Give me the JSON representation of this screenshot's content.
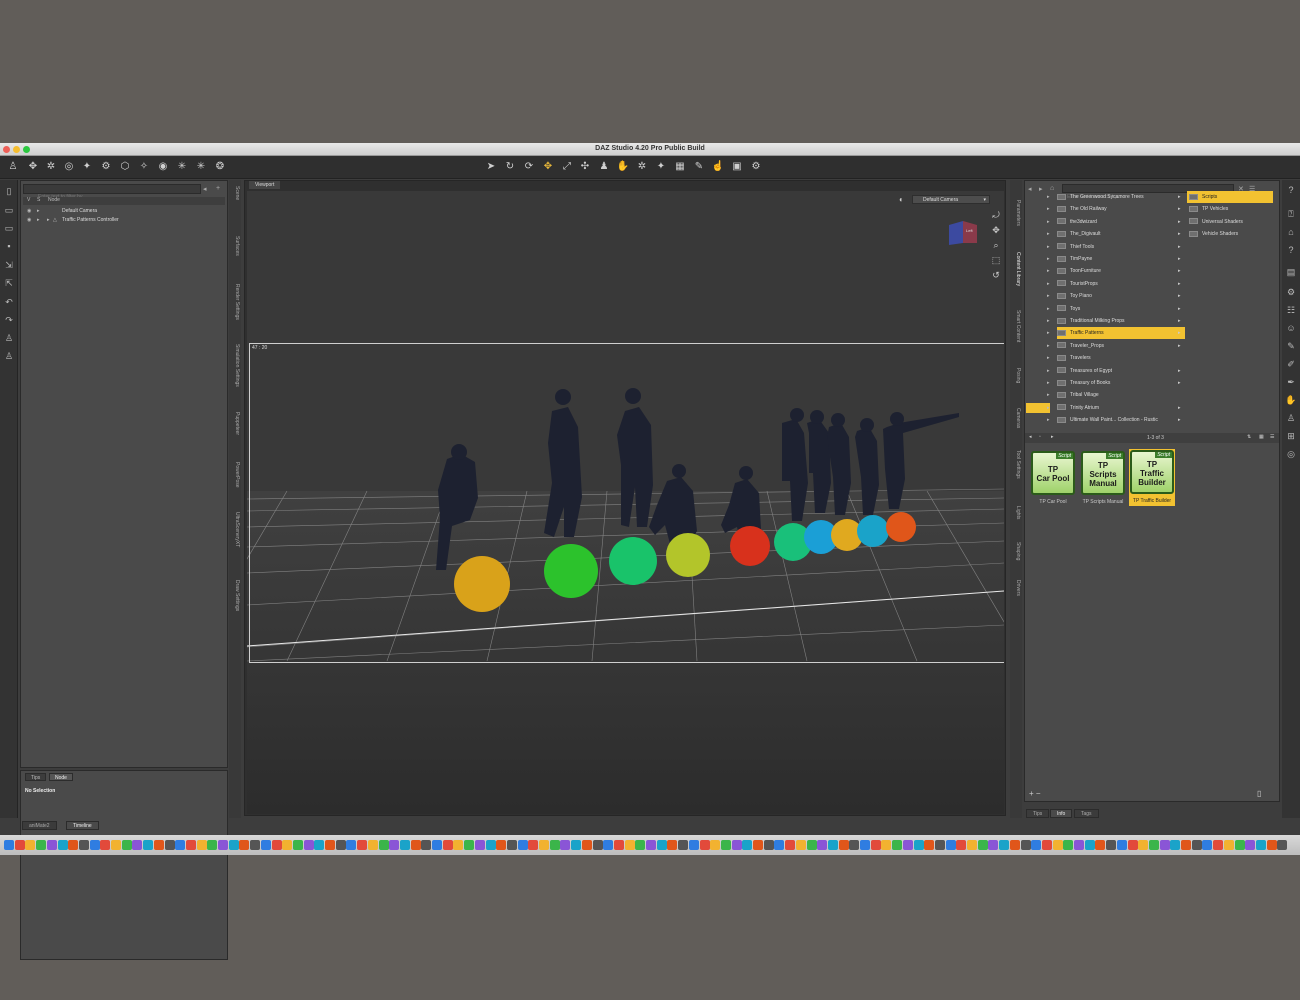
{
  "window": {
    "title": "DAZ Studio 4.20 Pro Public Build"
  },
  "scene": {
    "filter_placeholder": "Enter text to filter by...",
    "header_v": "V",
    "header_s": "S",
    "header_node": "Node",
    "nodes": [
      {
        "label": "Default Camera"
      },
      {
        "label": "Traffic Patterns Controller"
      }
    ]
  },
  "properties": {
    "tabs": [
      "Tips",
      "Node"
    ],
    "status": "No Selection"
  },
  "left_tabs": [
    "Scene",
    "Surfaces",
    "Render Settings",
    "Simulation Settings",
    "Puppeteer",
    "PowerPose",
    "UltraSceneryXT",
    "Draw Settings"
  ],
  "viewport": {
    "tab": "Viewport",
    "camera": "Default Camera",
    "aspect": "47 : 20",
    "cube_face": "Left"
  },
  "right_tabs": [
    "Parameters",
    "Content Library",
    "Smart Content",
    "Posing",
    "Cameras",
    "Tool Settings",
    "Lights",
    "Shaping",
    "Drivers"
  ],
  "content": {
    "search_placeholder": "Enter text to search by...",
    "folders": [
      {
        "label": "The Greenwood Sycamore Trees",
        "sub": true
      },
      {
        "label": "The Old Railway",
        "sub": true
      },
      {
        "label": "the3dwizard",
        "sub": true
      },
      {
        "label": "The_Digivault",
        "sub": true
      },
      {
        "label": "Thief Tools",
        "sub": true
      },
      {
        "label": "TimPayne",
        "sub": true
      },
      {
        "label": "ToonFurniture",
        "sub": true
      },
      {
        "label": "TouristProps",
        "sub": true
      },
      {
        "label": "Toy Piano",
        "sub": true
      },
      {
        "label": "Toys",
        "sub": true
      },
      {
        "label": "Traditional Milking Props",
        "sub": true
      },
      {
        "label": "Traffic Patterns",
        "sub": true,
        "selected": true
      },
      {
        "label": "Traveler_Props",
        "sub": true
      },
      {
        "label": "Travelers",
        "sub": false
      },
      {
        "label": "Treasures of Egypt",
        "sub": true
      },
      {
        "label": "Treasury of Books",
        "sub": true
      },
      {
        "label": "Tribal Village",
        "sub": false
      },
      {
        "label": "Trinity Atrium",
        "sub": true
      },
      {
        "label": "Ultimate Wall Paint... Collection - Rustic",
        "sub": true
      }
    ],
    "subfolders": [
      {
        "label": "Scripts",
        "selected": true
      },
      {
        "label": "TP Vehicles"
      },
      {
        "label": "Universal Shaders"
      },
      {
        "label": "Vehicle Shaders"
      }
    ],
    "count": "1-3 of 3",
    "assets": [
      {
        "badge": "Script",
        "tile_line1": "TP",
        "tile_line2": "Car Pool",
        "tile_line3": "",
        "name": "TP Car Pool"
      },
      {
        "badge": "Script",
        "tile_line1": "TP",
        "tile_line2": "Scripts",
        "tile_line3": "Manual",
        "name": "TP Scripts Manual"
      },
      {
        "badge": "Script",
        "tile_line1": "TP",
        "tile_line2": "Traffic",
        "tile_line3": "Builder",
        "name": "TP Traffic Builder",
        "selected": true
      }
    ],
    "bottom_tabs": [
      "Tips",
      "Info",
      "Tags"
    ]
  },
  "bottom_tabs": [
    "aniMate2",
    "Timeline"
  ],
  "colors": {
    "accent": "#f2c231",
    "panel": "#4a4a4a",
    "viewport": "#393939"
  },
  "scene_objects": {
    "ball_colors": [
      "#d9a21a",
      "#2cc22c",
      "#19c36a",
      "#b3c52a",
      "#d8311c",
      "#19c07a",
      "#1b9fd6",
      "#e0a91f",
      "#1aa3c9",
      "#e0561a"
    ]
  }
}
